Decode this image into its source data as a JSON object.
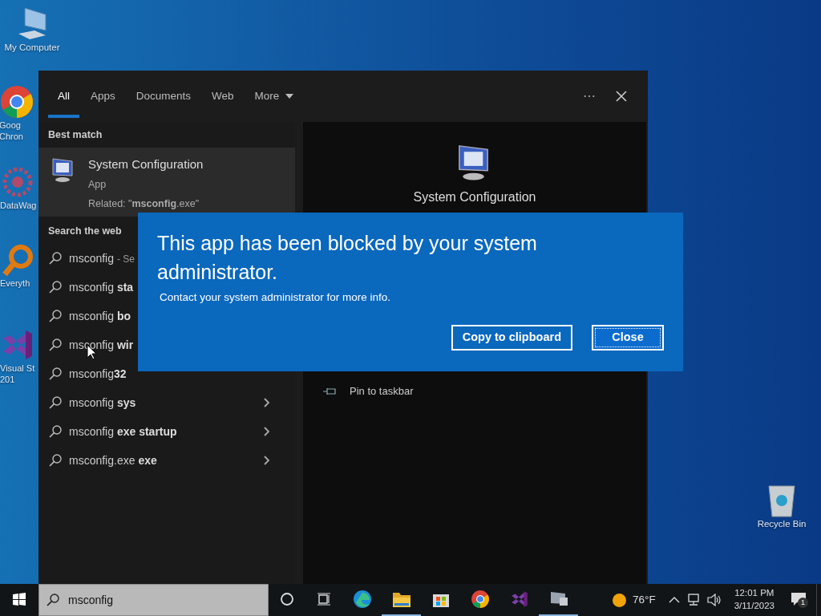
{
  "desktop_icons": [
    {
      "kind": "computer",
      "label_lines": [
        "My Computer"
      ]
    },
    {
      "kind": "chrome",
      "label_lines": [
        "Goog",
        "Chron"
      ]
    },
    {
      "kind": "datawag",
      "label_lines": [
        "DataWag"
      ]
    },
    {
      "kind": "everything",
      "label_lines": [
        "Everyth"
      ]
    },
    {
      "kind": "vs",
      "label_lines": [
        "Visual St",
        "201"
      ]
    },
    {
      "kind": "recycle",
      "label_lines": [
        "Recycle Bin"
      ]
    }
  ],
  "search_panel": {
    "tabs": [
      {
        "label": "All",
        "selected": true
      },
      {
        "label": "Apps",
        "selected": false
      },
      {
        "label": "Documents",
        "selected": false
      },
      {
        "label": "Web",
        "selected": false
      },
      {
        "label": "More",
        "selected": false,
        "dropdown": true
      }
    ],
    "more_options": "⋯",
    "best_match_heading": "Best match",
    "best_match": {
      "title": "System Configuration",
      "type": "App",
      "related": "Related: \"**msconfig**.exe\""
    },
    "web_heading": "Search the web",
    "web_results": [
      {
        "text": "msconfig - Se"
      },
      {
        "text": "msconfig **sta**"
      },
      {
        "text": "msconfig **bo**"
      },
      {
        "text": "msconfig **wir**"
      },
      {
        "text": "msconfig**32**"
      },
      {
        "text": "msconfig **sys**",
        "chevron": true
      },
      {
        "text": "msconfig **exe startup**",
        "chevron": true
      },
      {
        "text": "msconfig.exe **exe**",
        "chevron": true
      }
    ],
    "detail": {
      "title": "System Configuration",
      "actions": [
        {
          "label": "Pin to taskbar"
        }
      ]
    }
  },
  "dialog": {
    "title": "This app has been blocked by your system administrator.",
    "message": "Contact your system administrator for more info.",
    "buttons": [
      {
        "label": "Copy to clipboard",
        "focused": false
      },
      {
        "label": "Close",
        "focused": true
      }
    ]
  },
  "taskbar": {
    "search_value": "msconfig",
    "apps": [
      {
        "kind": "cortana",
        "running": false
      },
      {
        "kind": "taskview",
        "running": false
      },
      {
        "kind": "edge",
        "running": false
      },
      {
        "kind": "explorer",
        "running": true
      },
      {
        "kind": "store",
        "running": false
      },
      {
        "kind": "chrome",
        "running": false
      },
      {
        "kind": "vs",
        "running": false
      },
      {
        "kind": "msconfig",
        "running": true
      }
    ],
    "weather": "76°F",
    "time": "12:01 PM",
    "date": "3/11/2023",
    "notifications": "1"
  }
}
